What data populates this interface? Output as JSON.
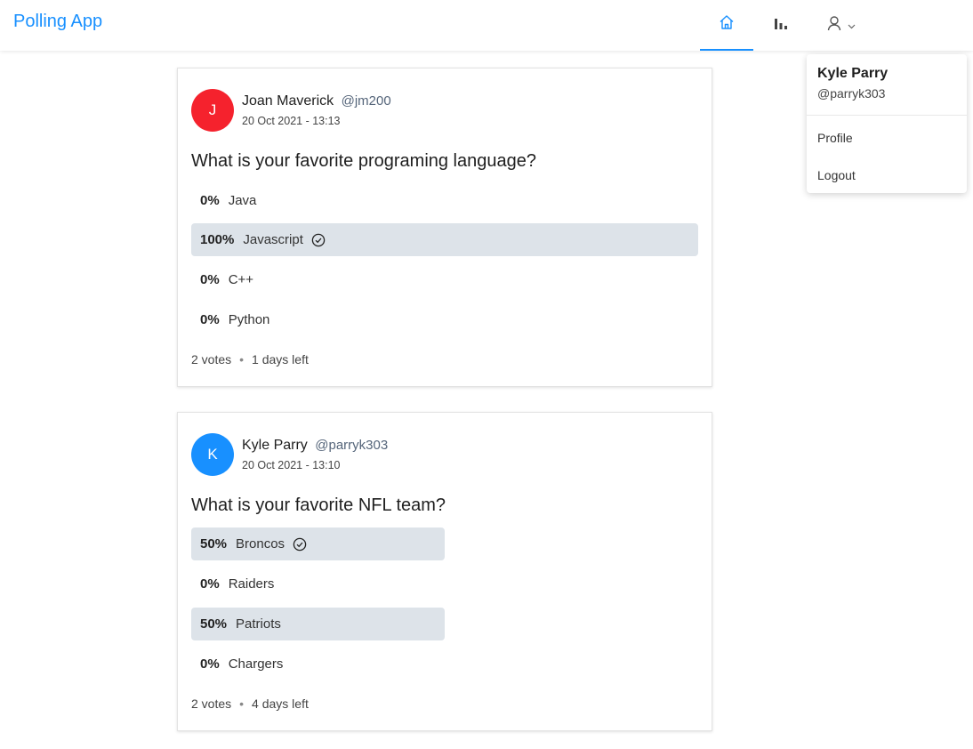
{
  "header": {
    "brand": "Polling App",
    "nav": {
      "home_icon": "home-icon",
      "stats_icon": "bar-chart-icon",
      "profile_icon": "user-icon",
      "chevron_icon": "chevron-down-icon"
    },
    "accent": "#1890ff"
  },
  "dropdown": {
    "name": "Kyle Parry",
    "username": "@parryk303",
    "items": [
      "Profile",
      "Logout"
    ]
  },
  "polls": [
    {
      "avatar_letter": "J",
      "avatar_color": "#f5222d",
      "author": "Joan Maverick",
      "username": "@jm200",
      "date": "20 Oct 2021 - 13:13",
      "question": "What is your favorite programing language?",
      "choices": [
        {
          "pct": "0%",
          "text": "Java",
          "fill": 0,
          "selected": false
        },
        {
          "pct": "100%",
          "text": "Javascript",
          "fill": 1.0,
          "selected": true
        },
        {
          "pct": "0%",
          "text": "C++",
          "fill": 0,
          "selected": false
        },
        {
          "pct": "0%",
          "text": "Python",
          "fill": 0,
          "selected": false
        }
      ],
      "votes": "2 votes",
      "time_left": "1 days left"
    },
    {
      "avatar_letter": "K",
      "avatar_color": "#1890ff",
      "author": "Kyle Parry",
      "username": "@parryk303",
      "date": "20 Oct 2021 - 13:10",
      "question": "What is your favorite NFL team?",
      "choices": [
        {
          "pct": "50%",
          "text": "Broncos",
          "fill": 0.5,
          "selected": true
        },
        {
          "pct": "0%",
          "text": "Raiders",
          "fill": 0,
          "selected": false
        },
        {
          "pct": "50%",
          "text": "Patriots",
          "fill": 0.5,
          "selected": false
        },
        {
          "pct": "0%",
          "text": "Chargers",
          "fill": 0,
          "selected": false
        }
      ],
      "votes": "2 votes",
      "time_left": "4 days left"
    }
  ]
}
